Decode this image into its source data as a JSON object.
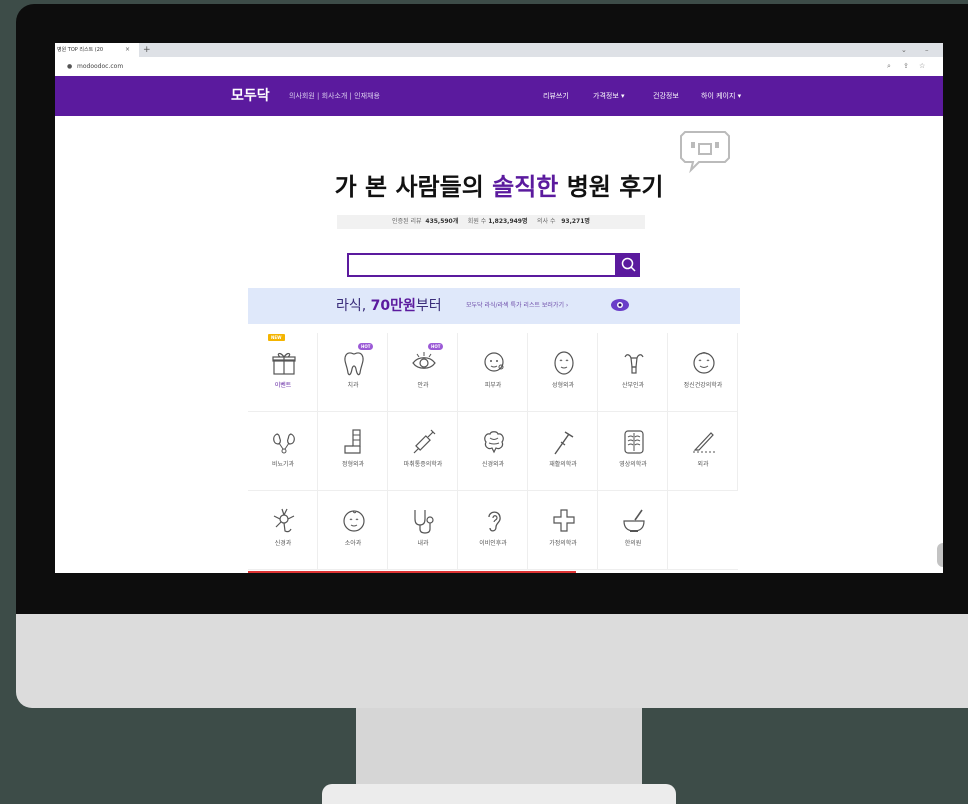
{
  "browser": {
    "tab_title": "병원 TOP 리스트 (20",
    "tab_close": "×",
    "new_tab": "+",
    "window_controls": [
      "⌄",
      "–"
    ],
    "url": "modoodoc.com",
    "address_icons": [
      "⌕",
      "⇪",
      "☆"
    ]
  },
  "nav": {
    "logo": "모두닥",
    "top_links": "의사회원 | 회사소개 | 인재채용",
    "menu": [
      "리뷰쓰기",
      "가격정보 ▾",
      "건강정보",
      "하이 케이지 ▾"
    ]
  },
  "hero": {
    "title_before": "가 본 사람들의 ",
    "title_accent": "솔직한",
    "title_after": " 병원 후기"
  },
  "stats": {
    "reviews_label": "인증된 리뷰",
    "reviews_value": "435,590개",
    "members_label": "회원 수",
    "members_value": "1,823,949명",
    "doctors_label": "의사 수",
    "doctors_value": "93,271명"
  },
  "banner": {
    "prefix": "라식, ",
    "highlight": "70만원",
    "suffix": "부터",
    "sub": "모두닥 라식/라섹 특가 리스트 보러가기 ›"
  },
  "categories": [
    {
      "label": "이벤트",
      "badge": "NEW"
    },
    {
      "label": "치과",
      "badge": "HOT"
    },
    {
      "label": "안과",
      "badge": "HOT"
    },
    {
      "label": "피부과"
    },
    {
      "label": "성형외과"
    },
    {
      "label": "산부인과"
    },
    {
      "label": "정신건강의학과"
    },
    {
      "label": "비뇨기과"
    },
    {
      "label": "정형외과"
    },
    {
      "label": "마취통증의학과"
    },
    {
      "label": "신경외과"
    },
    {
      "label": "재활의학과"
    },
    {
      "label": "영상의학과"
    },
    {
      "label": "외과"
    },
    {
      "label": "신경과"
    },
    {
      "label": "소아과"
    },
    {
      "label": "내과"
    },
    {
      "label": "이비인후과"
    },
    {
      "label": "가정의학과"
    },
    {
      "label": "한의원"
    }
  ],
  "colors": {
    "brand": "#5b1a9e",
    "banner_bg": "#dfe8fa",
    "new_badge": "#f4b400",
    "hot_badge": "#9b5ad6"
  }
}
